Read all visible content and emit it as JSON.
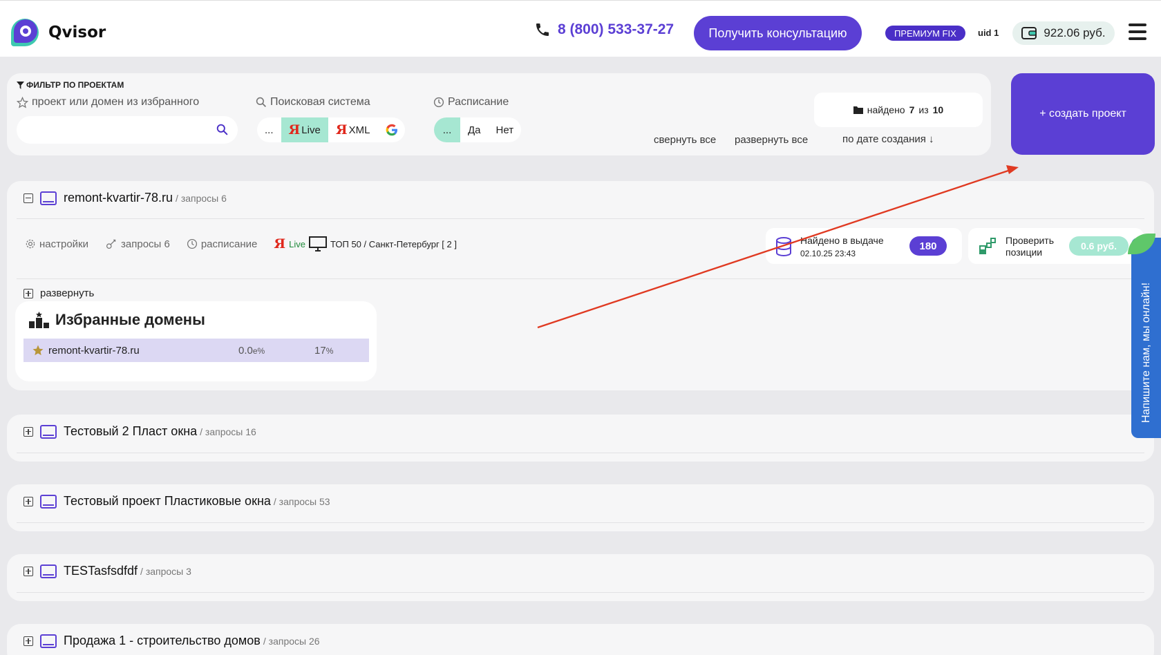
{
  "header": {
    "logo_text": "Qvisor",
    "phone": "8 (800) 533-37-27",
    "consult_label": "Получить консультацию",
    "plan_badge": "ПРЕМИУМ FIX",
    "uid": "uid 1",
    "balance": "922.06 руб."
  },
  "filter": {
    "title": "ФИЛЬТР ПО ПРОЕКТАМ",
    "favorites_label": "проект или домен из избранного",
    "search_placeholder": "",
    "engine_label": "Поисковая система",
    "engine_options": [
      "...",
      "Live",
      "XML",
      "G"
    ],
    "schedule_label": "Расписание",
    "schedule_options": [
      "...",
      "Да",
      "Нет"
    ],
    "found_prefix": "найдено",
    "found_count": "7",
    "found_of": "из",
    "found_total": "10",
    "collapse_all": "свернуть все",
    "expand_all": "развернуть все",
    "sort_label": "по дате создания ↓",
    "create_label": "+ создать проект"
  },
  "projects": [
    {
      "name": "remont-kvartir-78.ru",
      "meta": "/ запросы 6",
      "expanded": true
    },
    {
      "name": "Тестовый 2 Пласт окна",
      "meta": "/ запросы 16"
    },
    {
      "name": "Тестовый проект Пластиковые окна",
      "meta": "/ запросы 53"
    },
    {
      "name": "TESTasfsdfdf",
      "meta": "/ запросы 3"
    },
    {
      "name": "Продажа 1 - строительство домов",
      "meta": "/ запросы 26"
    }
  ],
  "expanded": {
    "settings": "настройки",
    "queries": "запросы 6",
    "schedule": "расписание",
    "engine": "Live",
    "region": "ТОП 50 / Санкт-Петербург [ 2 ]",
    "found_title": "Найдено в выдаче",
    "found_date": "02.10.25 23:43",
    "found_value": "180",
    "check_title_1": "Проверить",
    "check_title_2": "позиции",
    "check_price": "0.6 руб.",
    "expand_label": "развернуть",
    "favorites_title": "Избранные домены",
    "fav_domain": "remont-kvartir-78.ru",
    "fav_val1": "0.0",
    "fav_unit1": "е%",
    "fav_val2": "17",
    "fav_unit2": "%"
  },
  "chat": {
    "label": "Напишите нам, мы онлайн!"
  },
  "colors": {
    "accent": "#5b3fd4",
    "mint": "#a6e7d2",
    "chat": "#2f6fd0",
    "arrow": "#e03a22"
  }
}
